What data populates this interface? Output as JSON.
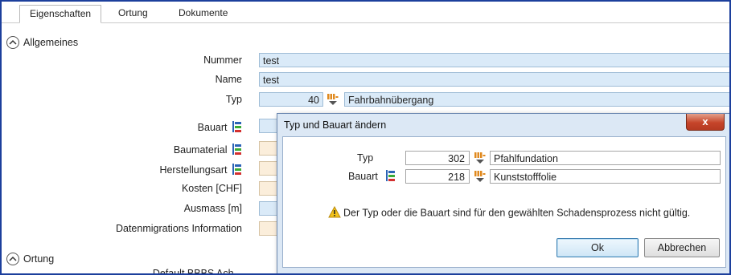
{
  "tabs": [
    {
      "label": "Eigenschaften"
    },
    {
      "label": "Ortung"
    },
    {
      "label": "Dokumente"
    }
  ],
  "sections": {
    "allgemeines": "Allgemeines",
    "ortung": "Ortung"
  },
  "fields": {
    "nummer": {
      "label": "Nummer",
      "value": "test"
    },
    "name": {
      "label": "Name",
      "value": "test"
    },
    "typ": {
      "label": "Typ",
      "code": "40",
      "value": "Fahrbahnübergang"
    },
    "bauart": {
      "label": "Bauart"
    },
    "baumaterial": {
      "label": "Baumaterial"
    },
    "herstellungsart": {
      "label": "Herstellungsart"
    },
    "kosten": {
      "label": "Kosten [CHF]"
    },
    "ausmass": {
      "label": "Ausmass [m]"
    },
    "datenmigration": {
      "label": "Datenmigrations Information"
    },
    "partial_label": "Default BBBS Ach..."
  },
  "dialog": {
    "title": "Typ und Bauart ändern",
    "close_label": "x",
    "typ_label": "Typ",
    "typ_code": "302",
    "typ_value": "Pfahlfundation",
    "bauart_label": "Bauart",
    "bauart_code": "218",
    "bauart_value": "Kunststofffolie",
    "warning": "Der Typ oder die Bauart sind für den gewählten Schadensprozess nicht gültig.",
    "ok_label": "Ok",
    "cancel_label": "Abbrechen"
  },
  "colors": {
    "frame": "#1c3f9c",
    "field_blue": "#daeaf8",
    "field_tan": "#fbeedb",
    "dialog_bg": "#dce8f5",
    "close_red": "#c6452a"
  }
}
